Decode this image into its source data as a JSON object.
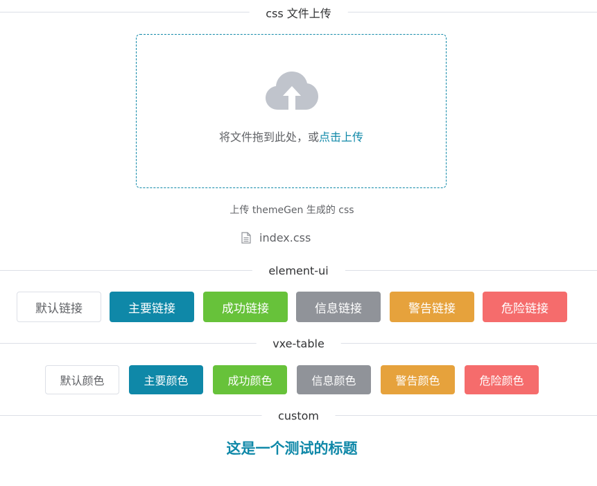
{
  "colors": {
    "primary": "#0f88a8",
    "success": "#67c23a",
    "info": "#909399",
    "warning": "#e6a23c",
    "danger": "#f56c6c",
    "default_border": "#dcdfe6",
    "upload_icon": "#c0c4cc"
  },
  "upload_section": {
    "title": "css 文件上传",
    "drag_text": "将文件拖到此处，或",
    "click_text": "点击上传",
    "tip": "上传 themeGen 生成的 css",
    "icon": "cloud-upload-icon",
    "file": {
      "icon": "document-icon",
      "name": "index.css"
    }
  },
  "element_section": {
    "title": "element-ui",
    "buttons": [
      {
        "label": "默认链接",
        "type": "default"
      },
      {
        "label": "主要链接",
        "type": "primary"
      },
      {
        "label": "成功链接",
        "type": "success"
      },
      {
        "label": "信息链接",
        "type": "info"
      },
      {
        "label": "警告链接",
        "type": "warning"
      },
      {
        "label": "危险链接",
        "type": "danger"
      }
    ]
  },
  "vxe_section": {
    "title": "vxe-table",
    "buttons": [
      {
        "label": "默认颜色",
        "type": "default"
      },
      {
        "label": "主要颜色",
        "type": "primary"
      },
      {
        "label": "成功颜色",
        "type": "success"
      },
      {
        "label": "信息颜色",
        "type": "info"
      },
      {
        "label": "警告颜色",
        "type": "warning"
      },
      {
        "label": "危险颜色",
        "type": "danger"
      }
    ]
  },
  "custom_section": {
    "title": "custom",
    "heading": "这是一个测试的标题"
  }
}
